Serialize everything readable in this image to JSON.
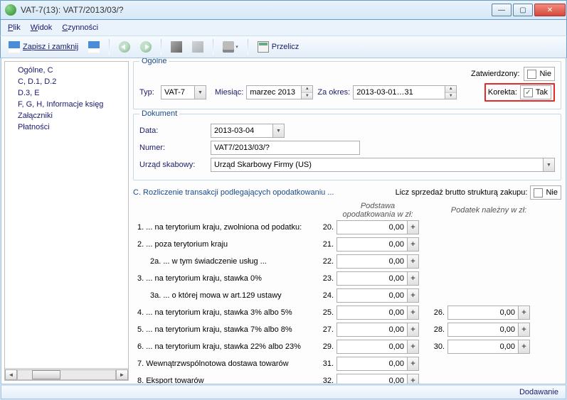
{
  "window": {
    "title": "VAT-7(13): VAT7/2013/03/?"
  },
  "menu": {
    "file": "Plik",
    "view": "Widok",
    "actions": "Czynności"
  },
  "toolbar": {
    "save_close": "Zapisz i zamknij",
    "recalc": "Przelicz"
  },
  "sidebar": {
    "items": [
      "Ogólne, C",
      "C, D.1, D.2",
      "D.3, E",
      "F, G, H, Informacje księg",
      "Załączniki",
      "Płatności"
    ]
  },
  "general": {
    "legend": "Ogólne",
    "approved_label": "Zatwierdzony:",
    "approved_value": "Nie",
    "type_label": "Typ:",
    "type_value": "VAT-7",
    "month_label": "Miesiąc:",
    "month_value": "marzec 2013",
    "period_label": "Za okres:",
    "period_value": "2013-03-01…31",
    "korekta_label": "Korekta:",
    "korekta_value": "Tak"
  },
  "dokument": {
    "legend": "Dokument",
    "date_label": "Data:",
    "date_value": "2013-03-04",
    "number_label": "Numer:",
    "number_value": "VAT7/2013/03/?",
    "office_label": "Urząd skabowy:",
    "office_value": "Urząd Skarbowy Firmy (US)"
  },
  "sectionC": {
    "title": "C. Rozliczenie transakcji podlegających opodatkowaniu ...",
    "brutto_label": "Licz sprzedaż brutto strukturą zakupu:",
    "brutto_value": "Nie",
    "col1_header": "Podstawa opodatkowania w zł:",
    "col2_header": "Podatek należny w zł:",
    "rows": [
      {
        "desc": "1. ... na terytorium kraju, zwolniona od podatku:",
        "n1": "20.",
        "v1": "0,00"
      },
      {
        "desc": "2. ... poza terytorium kraju",
        "n1": "21.",
        "v1": "0,00"
      },
      {
        "desc": "   2a. ... w tym świadczenie usług ...",
        "n1": "22.",
        "v1": "0,00"
      },
      {
        "desc": "3. ... na terytorium kraju, stawka 0%",
        "n1": "23.",
        "v1": "0,00"
      },
      {
        "desc": "   3a. ... o której mowa w art.129 ustawy",
        "n1": "24.",
        "v1": "0,00"
      },
      {
        "desc": "4. ... na terytorium kraju, stawka 3% albo 5%",
        "n1": "25.",
        "v1": "0,00",
        "n2": "26.",
        "v2": "0,00"
      },
      {
        "desc": "5. ... na terytorium kraju, stawka 7% albo 8%",
        "n1": "27.",
        "v1": "0,00",
        "n2": "28.",
        "v2": "0,00"
      },
      {
        "desc": "6. ... na terytorium kraju, stawka 22% albo 23%",
        "n1": "29.",
        "v1": "0,00",
        "n2": "30.",
        "v2": "0,00"
      },
      {
        "desc": "7. Wewnątrzwspólnotowa dostawa towarów",
        "n1": "31.",
        "v1": "0,00"
      },
      {
        "desc": "8. Eksport towarów",
        "n1": "32.",
        "v1": "0,00"
      }
    ]
  },
  "status": "Dodawanie"
}
